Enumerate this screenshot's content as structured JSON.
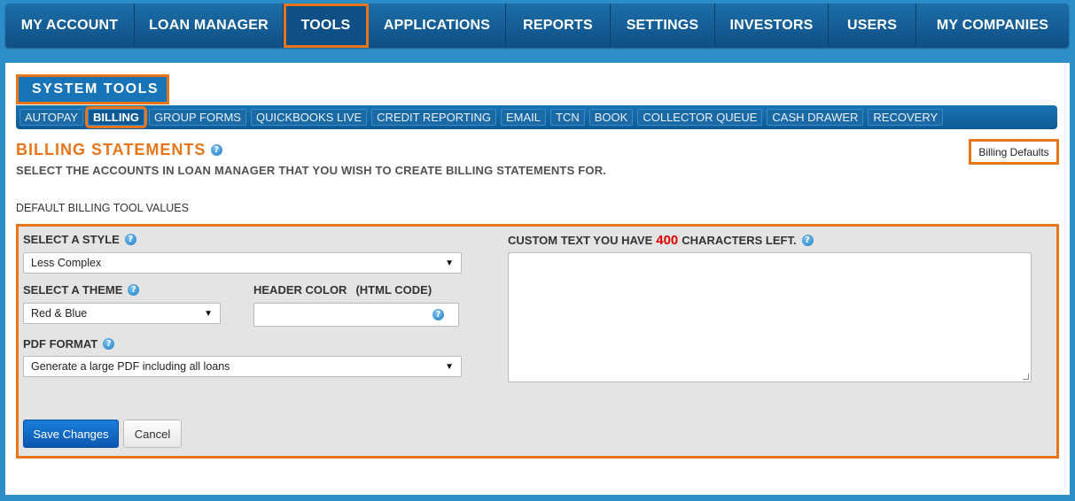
{
  "topnav": {
    "items": [
      {
        "label": "MY ACCOUNT"
      },
      {
        "label": "LOAN MANAGER"
      },
      {
        "label": "TOOLS"
      },
      {
        "label": "APPLICATIONS"
      },
      {
        "label": "REPORTS"
      },
      {
        "label": "SETTINGS"
      },
      {
        "label": "INVESTORS"
      },
      {
        "label": "USERS"
      },
      {
        "label": "MY COMPANIES"
      }
    ],
    "active": "TOOLS"
  },
  "section": {
    "title": "SYSTEM TOOLS"
  },
  "subnav": {
    "items": [
      {
        "label": "AUTOPAY"
      },
      {
        "label": "BILLING"
      },
      {
        "label": "GROUP FORMS"
      },
      {
        "label": "QUICKBOOKS LIVE"
      },
      {
        "label": "CREDIT REPORTING"
      },
      {
        "label": "EMAIL"
      },
      {
        "label": "TCN"
      },
      {
        "label": "BOOK"
      },
      {
        "label": "COLLECTOR QUEUE"
      },
      {
        "label": "CASH DRAWER"
      },
      {
        "label": "RECOVERY"
      }
    ],
    "active": "BILLING"
  },
  "page": {
    "title": "BILLING STATEMENTS",
    "subtitle": "SELECT THE ACCOUNTS IN LOAN MANAGER THAT YOU WISH TO CREATE BILLING STATEMENTS FOR.",
    "billing_defaults_label": "Billing Defaults",
    "section_label": "DEFAULT BILLING TOOL VALUES"
  },
  "form": {
    "style_label": "SELECT A STYLE",
    "style_value": "Less Complex",
    "theme_label": "SELECT A THEME",
    "theme_value": "Red & Blue",
    "header_color_label": "HEADER COLOR",
    "header_color_hint": "(HTML CODE)",
    "header_color_value": "",
    "pdf_label": "PDF FORMAT",
    "pdf_value": "Generate a large PDF including all loans",
    "custom_text_prefix": "CUSTOM TEXT YOU HAVE",
    "custom_text_count": "400",
    "custom_text_suffix": "CHARACTERS LEFT.",
    "custom_text_value": "",
    "save_label": "Save Changes",
    "cancel_label": "Cancel"
  },
  "icons": {
    "help": "help-icon",
    "dropdown": "chevron-down-icon"
  },
  "colors": {
    "highlight": "#e8751a",
    "nav": "#0e4f85",
    "accent_text": "#e8751a",
    "char_count": "#e00000"
  }
}
